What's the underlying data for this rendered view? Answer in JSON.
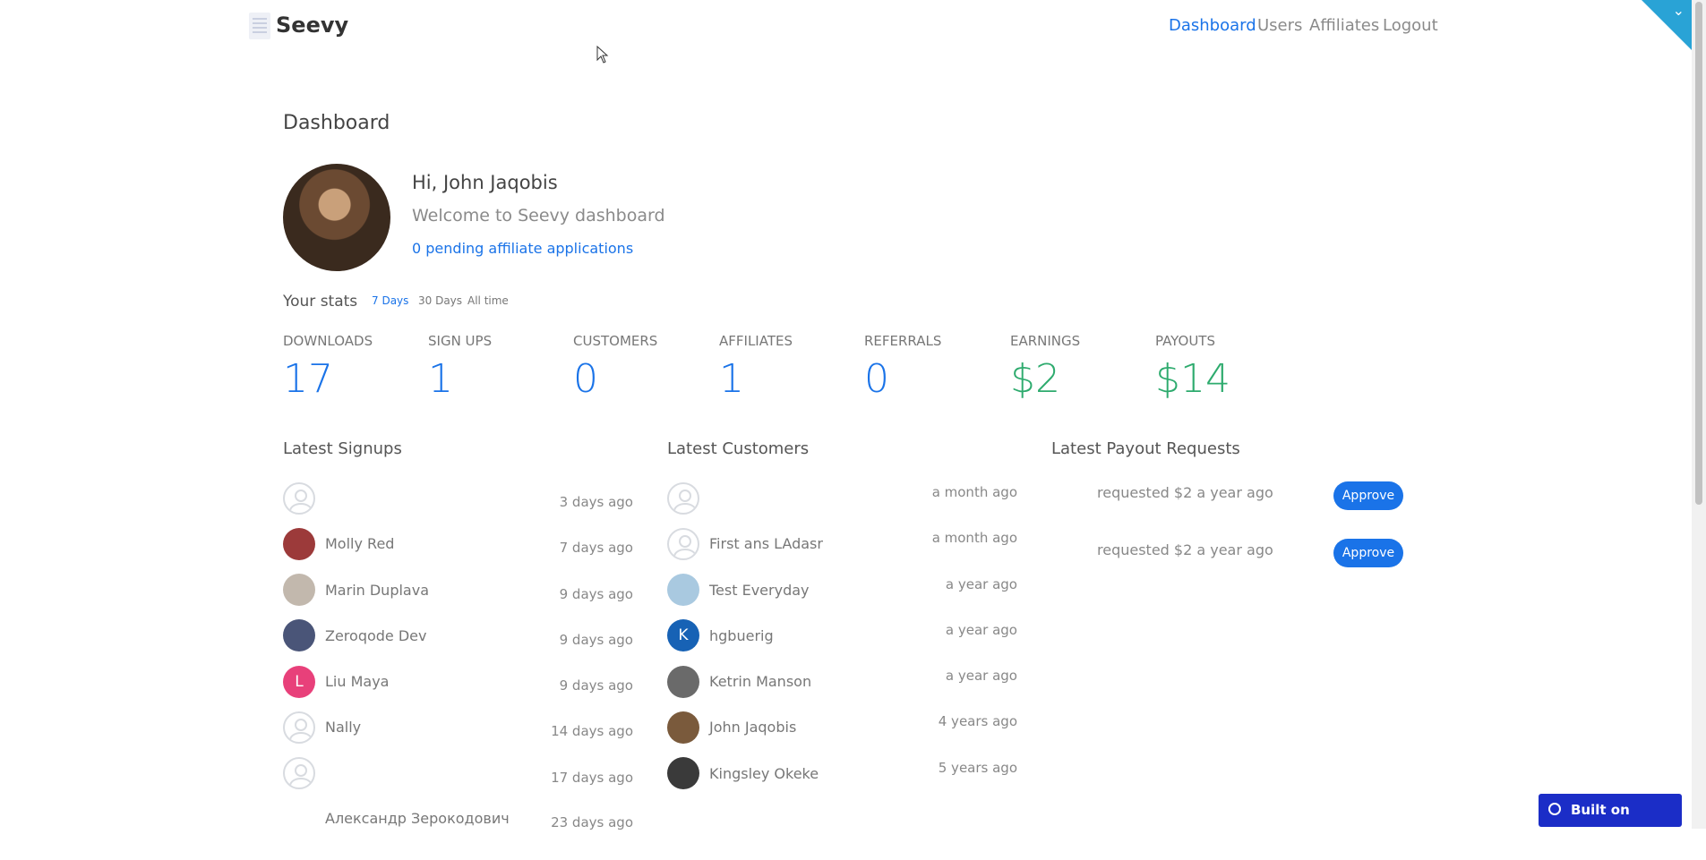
{
  "header": {
    "brand": "Seevy",
    "nav": [
      {
        "label": "Dashboard",
        "active": true
      },
      {
        "label": "Users",
        "active": false
      },
      {
        "label": "Affiliates",
        "active": false
      },
      {
        "label": "Logout",
        "active": false
      }
    ],
    "corner_icon": "chevron-down-icon"
  },
  "page": {
    "title": "Dashboard",
    "greeting": "Hi, John Jaqobis",
    "welcome": "Welcome to Seevy dashboard",
    "pending_link": "0 pending affiliate applications"
  },
  "stats": {
    "label": "Your stats",
    "ranges": [
      {
        "label": "7 Days",
        "active": true
      },
      {
        "label": "30 Days",
        "active": false
      },
      {
        "label": "All time",
        "active": false
      }
    ],
    "items": [
      {
        "name": "DOWNLOADS",
        "value": "17",
        "color": "#1a73e8"
      },
      {
        "name": "SIGN UPS",
        "value": "1",
        "color": "#1a73e8"
      },
      {
        "name": "CUSTOMERS",
        "value": "0",
        "color": "#1a73e8"
      },
      {
        "name": "AFFILIATES",
        "value": "1",
        "color": "#1a73e8"
      },
      {
        "name": "REFERRALS",
        "value": "0",
        "color": "#1a73e8"
      },
      {
        "name": "EARNINGS",
        "value": "$2",
        "color": "#2eab6e"
      },
      {
        "name": "PAYOUTS",
        "value": "$14",
        "color": "#2eab6e"
      }
    ]
  },
  "signups": {
    "title": "Latest Signups",
    "rows": [
      {
        "name": "",
        "time": "3 days ago",
        "avatar": "placeholder"
      },
      {
        "name": "Molly Red",
        "time": "7 days ago",
        "avatar": "photo"
      },
      {
        "name": "Marin  Duplava",
        "time": "9 days ago",
        "avatar": "photo"
      },
      {
        "name": "Zeroqode Dev",
        "time": "9 days ago",
        "avatar": "photo"
      },
      {
        "name": "Liu Maya",
        "time": "9 days ago",
        "avatar": "letter",
        "letter": "L",
        "color": "#e8407a"
      },
      {
        "name": "Nally",
        "time": "14 days ago",
        "avatar": "placeholder"
      },
      {
        "name": "",
        "time": "17 days ago",
        "avatar": "placeholder"
      },
      {
        "name": "Александр  Зерокодович",
        "time": "23 days ago",
        "avatar": "none"
      }
    ]
  },
  "customers": {
    "title": "Latest Customers",
    "rows": [
      {
        "name": "",
        "time": "a month ago",
        "avatar": "placeholder"
      },
      {
        "name": "First ans LAdasr",
        "time": "a month ago",
        "avatar": "placeholder"
      },
      {
        "name": "Test Everyday",
        "time": "a year ago",
        "avatar": "photo"
      },
      {
        "name": "hgbuerig",
        "time": "a year ago",
        "avatar": "letter",
        "letter": "K",
        "color": "#1762b5"
      },
      {
        "name": "Ketrin Manson",
        "time": "a year ago",
        "avatar": "photo"
      },
      {
        "name": "John Jaqobis",
        "time": "4 years ago",
        "avatar": "photo"
      },
      {
        "name": "Kingsley Okeke",
        "time": "5 years ago",
        "avatar": "photo"
      }
    ]
  },
  "payouts": {
    "title": "Latest Payout Requests",
    "rows": [
      {
        "text": "requested $2 a year ago",
        "button": "Approve"
      },
      {
        "text": "requested $2 a year ago",
        "button": "Approve"
      }
    ]
  },
  "badge": {
    "label": "Built on Bubble",
    "icon": "bubble-logo-icon"
  },
  "colors": {
    "accent": "#1a73e8",
    "money": "#2eab6e",
    "badge": "#1b2dc7",
    "corner": "#29a3d6"
  }
}
